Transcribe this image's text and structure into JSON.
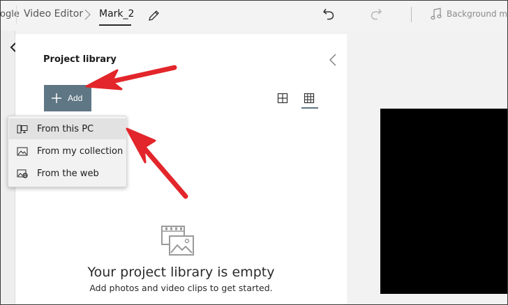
{
  "titlebar": {
    "google_partial": "ogle",
    "breadcrumb_root": "Video Editor",
    "breadcrumb_current": "Mark_2",
    "background_music": "Background music"
  },
  "library": {
    "title": "Project library",
    "add_label": "Add",
    "empty_title": "Your project library is empty",
    "empty_subtitle": "Add photos and video clips to get started."
  },
  "menu": {
    "items": [
      {
        "label": "From this PC",
        "icon": "pc-icon"
      },
      {
        "label": "From my collection",
        "icon": "collection-icon"
      },
      {
        "label": "From the web",
        "icon": "web-icon"
      }
    ]
  },
  "colors": {
    "add_button": "#5f7684",
    "annotation_arrow": "#e2262b",
    "preview": "#000000"
  }
}
